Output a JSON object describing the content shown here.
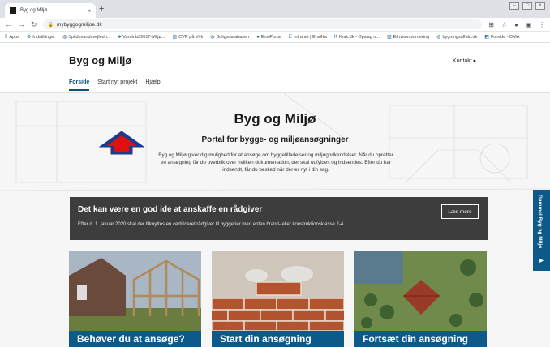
{
  "browser": {
    "tab_title": "Byg og Miljø",
    "tab_close": "×",
    "new_tab": "+",
    "url": "mybyggogmiljoe.dk",
    "bookmarks": [
      {
        "icon": "apps-icon",
        "label": "Apps"
      },
      {
        "icon": "gear-icon",
        "label": "Indstillinger"
      },
      {
        "icon": "globe-icon",
        "label": "Spildevandsvejledn..."
      },
      {
        "icon": "tree-icon",
        "label": "Vandråd 2017-Miljø..."
      },
      {
        "icon": "building-icon",
        "label": "CVR på Virk"
      },
      {
        "icon": "globe-icon",
        "label": "Boligsdatabasen"
      },
      {
        "icon": "drop-icon",
        "label": "EnviPortal"
      },
      {
        "icon": "e-icon",
        "label": "Intranet | EnviNa"
      },
      {
        "icon": "k-icon",
        "label": "Krak.dk - Opslag n..."
      },
      {
        "icon": "building-icon",
        "label": "Erhvervsvurdering"
      },
      {
        "icon": "globe-icon",
        "label": "bygningsaffald.dk"
      },
      {
        "icon": "map-icon",
        "label": "Forside - DMA"
      }
    ]
  },
  "site": {
    "logo": "Byg og Miljø",
    "contact": "Kontakt ▸",
    "nav": [
      "Forside",
      "Start nyt projekt",
      "Hjælp"
    ],
    "hero_title": "Byg og Miljø",
    "hero_subtitle": "Portal for bygge- og miljøansøgninger",
    "hero_desc": "Byg og Miljø giver dig mulighed for at ansøge om byggetilladelser og miljøgodkendelser. Når du opretter en ansøgning får du overblik over hvilken dokumentation, der skal udfyldes og indsendes. Efter du har indsendt, får du besked når der er nyt i din sag.",
    "banner_title": "Det kan være en god ide at anskaffe en rådgiver",
    "banner_text": "Efter d. 1. januar 2020 skal der tilknyttes en certificeret rådgiver til byggerier med enten brand- eller konstruktionsklasse 2-4.",
    "banner_button": "Læs mere",
    "cards": [
      "Behøver du at ansøge?",
      "Start din ansøgning",
      "Fortsæt din ansøgning"
    ],
    "side_tab": "Gammel Byg og Miljø"
  },
  "colors": {
    "brand": "#0d5a8a",
    "banner_bg": "#3d3d3d",
    "arrow_outline": "#1e3a8a",
    "arrow_fill": "#e01010"
  }
}
